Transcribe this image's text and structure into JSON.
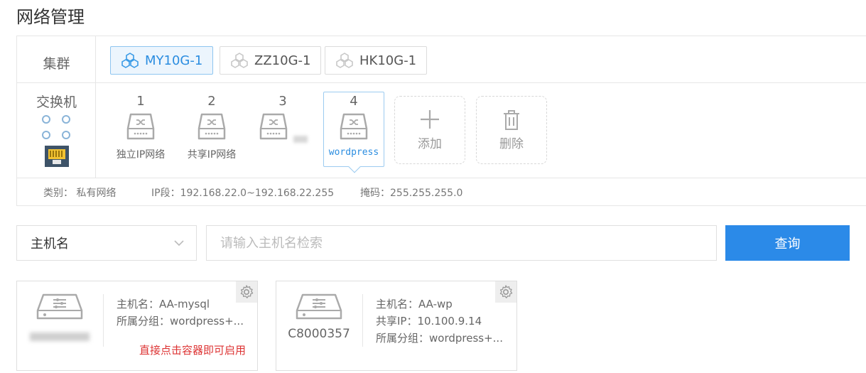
{
  "page": {
    "title": "网络管理"
  },
  "cluster": {
    "label": "集群",
    "items": [
      {
        "label": "MY10G-1",
        "active": true
      },
      {
        "label": "ZZ10G-1",
        "active": false
      },
      {
        "label": "HK10G-1",
        "active": false
      }
    ]
  },
  "switches": {
    "label": "交换机",
    "items": [
      {
        "num": "1",
        "name": "独立IP网络"
      },
      {
        "num": "2",
        "name": "共享IP网络"
      },
      {
        "num": "3",
        "name": ""
      },
      {
        "num": "4",
        "name": "wordpress"
      }
    ],
    "add_label": "添加",
    "delete_label": "删除"
  },
  "network_info": {
    "type": "类别：  私有网络",
    "ip_range": "IP段：192.168.22.0~192.168.22.255",
    "mask": "掩码：255.255.255.0"
  },
  "search": {
    "select_value": "主机名",
    "placeholder": "请输入主机名检索",
    "button_label": "查询"
  },
  "hosts": [
    {
      "id": "",
      "hostname": "主机名：AA-mysql",
      "group": "所属分组：wordpress+...",
      "hint": "直接点击容器即可启用"
    },
    {
      "id": "C8000357",
      "hostname": "主机名：AA-wp",
      "shared_ip": "共享IP：10.100.9.14",
      "group": "所属分组：wordpress+..."
    }
  ],
  "colors": {
    "accent": "#2b8ae8",
    "active_blue": "#2b8de0",
    "hint_red": "#dd3333"
  }
}
